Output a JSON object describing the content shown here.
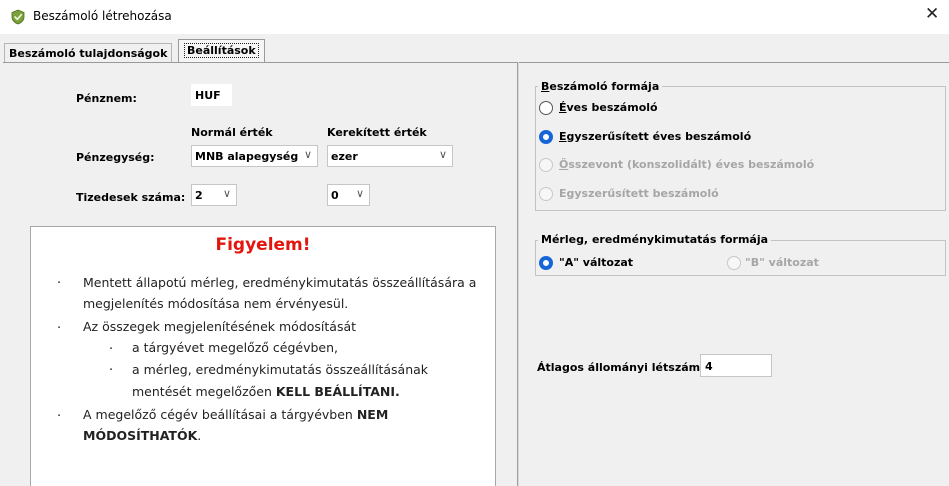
{
  "window": {
    "title": "Beszámoló létrehozása",
    "close_glyph": "✕"
  },
  "tabs": [
    {
      "label": "Beszámoló tulajdonságok",
      "active": false
    },
    {
      "label": "Beállítások",
      "active": true
    }
  ],
  "settings": {
    "currency_label": "Pénznem:",
    "currency_value": "HUF",
    "normal_header": "Normál érték",
    "rounded_header": "Kerekített érték",
    "unit_label": "Pénzegység:",
    "unit_normal": "MNB alapegység",
    "unit_rounded": "ezer",
    "decimals_label": "Tizedesek száma:",
    "decimals_normal": "2",
    "decimals_rounded": "0"
  },
  "notice": {
    "title": "Figyelem!",
    "line1": "Mentett állapotú mérleg, eredménykimutatás összeállítására a",
    "line2": "megjelenítés módosítása nem érvényesül.",
    "line3": "Az összegek megjelenítésének módosítását",
    "line4": "a tárgyévet megelőző cégévben,",
    "line5": "a mérleg, eredménykimutatás összeállításának",
    "line6_normal": "mentését megelőzően ",
    "line6_bold": "KELL BEÁLLÍTANI.",
    "line7_normal": "A megelőző cégév beállításai a tárgyévben ",
    "line7_bold": "NEM",
    "line8_bold": "MÓDOSÍTHATÓK",
    "line8_end": "."
  },
  "report_form": {
    "group_label": "Beszámoló formája",
    "options": [
      {
        "label": "Éves beszámoló",
        "checked": false,
        "enabled": true
      },
      {
        "label": "Egyszerűsített éves beszámoló",
        "checked": true,
        "enabled": true
      },
      {
        "label": "Összevont (konszolidált) éves beszámoló",
        "checked": false,
        "enabled": false
      },
      {
        "label": "Egyszerűsített beszámoló",
        "checked": false,
        "enabled": false
      }
    ]
  },
  "balance_form": {
    "group_label": "Mérleg, eredménykimutatás formája",
    "options": [
      {
        "label": "\"A\" változat",
        "checked": true,
        "enabled": true
      },
      {
        "label": "\"B\" változat",
        "checked": false,
        "enabled": false
      }
    ]
  },
  "headcount": {
    "label": "Átlagos állományi létszám:",
    "value": "4"
  },
  "colors": {
    "accent": "#1565d8",
    "warning": "#e2150f",
    "disabled": "#a6a6a6"
  }
}
